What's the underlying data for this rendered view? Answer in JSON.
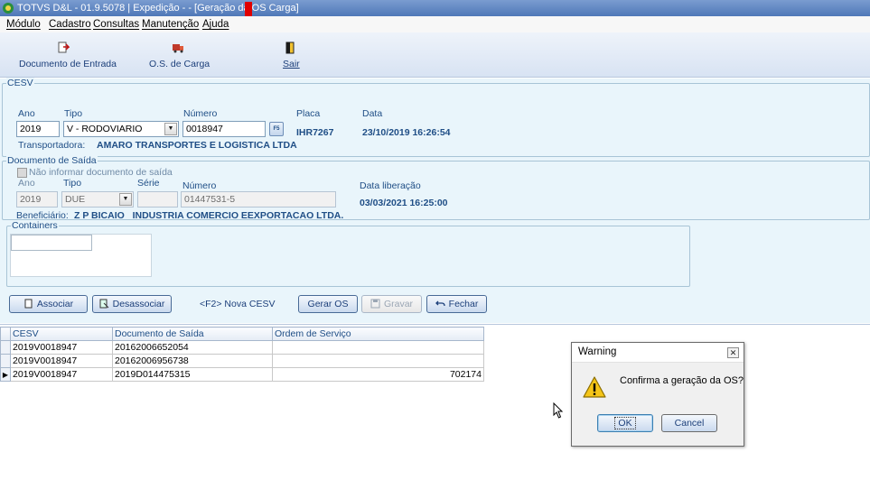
{
  "window": {
    "title": "TOTVS D&L - 01.9.5078 | Expedição - - [Geração da OS Carga]",
    "icon": "app-logo-icon"
  },
  "menu": [
    {
      "label": "Módulo"
    },
    {
      "label": "Cadastro"
    },
    {
      "label": "Consultas"
    },
    {
      "label": "Manutenção"
    },
    {
      "label": "Ajuda"
    }
  ],
  "toolbar": {
    "documento_entrada": {
      "label": "Documento de Entrada",
      "icon": "document-entry-icon"
    },
    "os_carga": {
      "label": "O.S. de Carga",
      "icon": "truck-icon"
    },
    "sair": {
      "label": "Sair",
      "icon": "exit-door-icon"
    }
  },
  "cesv": {
    "group_title": "CESV",
    "ano_label": "Ano",
    "ano_value": "2019",
    "tipo_label": "Tipo",
    "tipo_value": "V - RODOVIARIO",
    "numero_label": "Número",
    "numero_value": "0018947",
    "placa_label": "Placa",
    "placa_value": "IHR7267",
    "data_label": "Data",
    "data_value": "23/10/2019 16:26:54",
    "transportadora_label": "Transportadora:",
    "transportadora_value": "AMARO TRANSPORTES E LOGISTICA LTDA",
    "search_button": "F5"
  },
  "documento_saida": {
    "group_title": "Documento de Saída",
    "checkbox_label": "Não informar documento de saída",
    "ano_label": "Ano",
    "ano_value": "2019",
    "tipo_label": "Tipo",
    "tipo_value": "DUE",
    "serie_label": "Série",
    "serie_value": "",
    "numero_label": "Número",
    "numero_value": "01447531-5",
    "data_liberacao_label": "Data liberação",
    "data_liberacao_value": "03/03/2021 16:25:00",
    "beneficiario_label": "Beneficiário:",
    "beneficiario_value": "Z P BICAIO   INDUSTRIA COMERCIO EEXPORTACAO LTDA."
  },
  "containers": {
    "group_title": "Containers"
  },
  "actions": {
    "associar": "Associar",
    "desassociar": "Desassociar",
    "hint": "<F2> Nova CESV",
    "gerar_os": "Gerar OS",
    "gravar": "Gravar",
    "fechar": "Fechar"
  },
  "grid": {
    "columns": [
      "CESV",
      "Documento de Saída",
      "Ordem de Serviço"
    ],
    "rows": [
      {
        "cesv": "2019V0018947",
        "documento": "20162006652054",
        "ordem": ""
      },
      {
        "cesv": "2019V0018947",
        "documento": "20162006956738",
        "ordem": ""
      },
      {
        "cesv": "2019V0018947",
        "documento": "2019D014475315",
        "ordem": "702174"
      }
    ],
    "current_row_indicator": "▶"
  },
  "dialog": {
    "title": "Warning",
    "message": "Confirma a geração da OS?",
    "ok": "OK",
    "cancel": "Cancel",
    "icon": "warning-icon"
  },
  "colors": {
    "accent": "#1f4e86",
    "form_bg": "#e9f5fb",
    "title_bar": "#4f78b8"
  }
}
